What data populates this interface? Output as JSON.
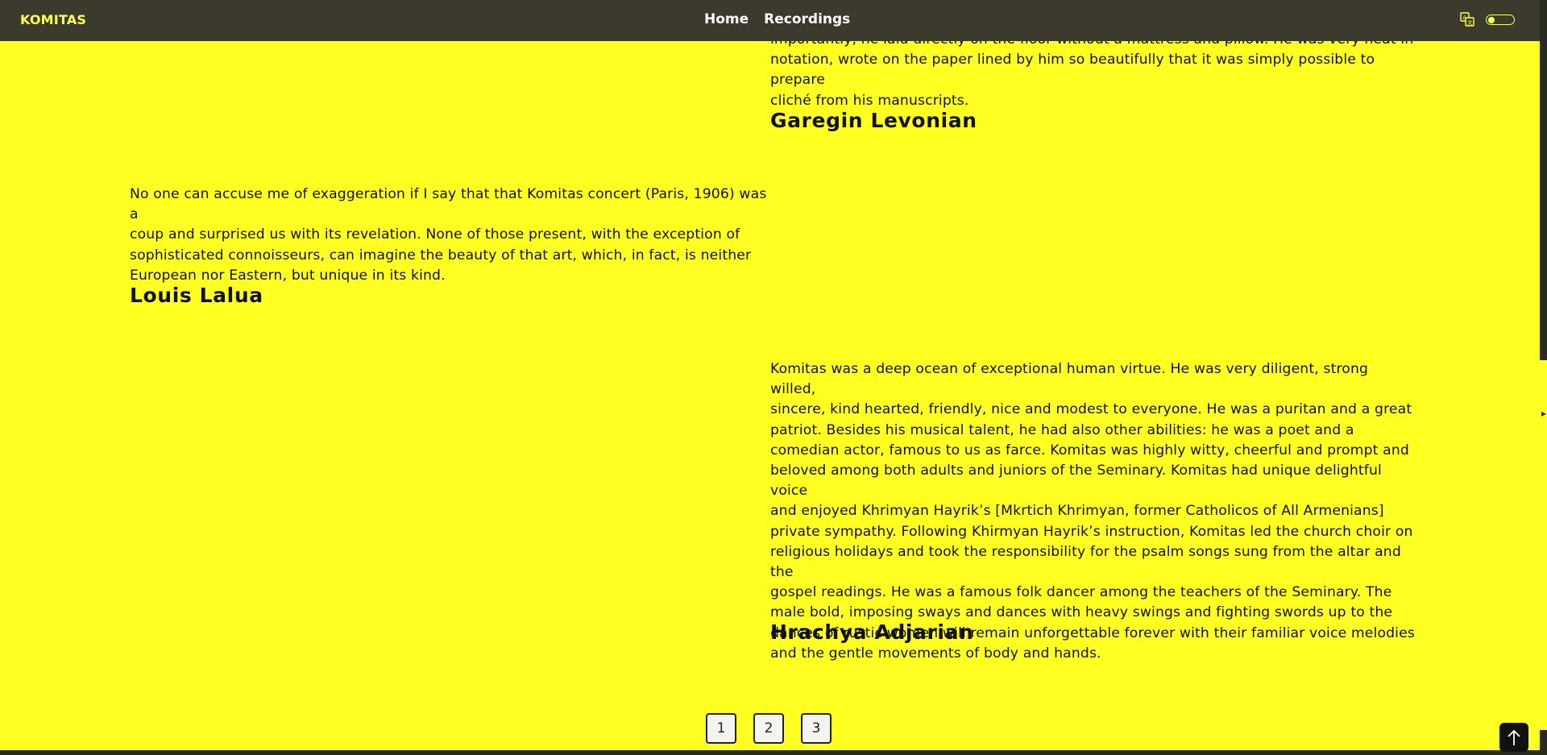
{
  "nav": {
    "brand": "KOMITAS",
    "links": [
      "Home",
      "Recordings"
    ]
  },
  "icons": {
    "translate": "translate-icon",
    "theme_toggle": "theme-toggle",
    "to_top": "arrow-up-icon"
  },
  "colors": {
    "page_background": "#ffff22",
    "navbar_background": "#3b3a2c",
    "brand_color": "#ffff55",
    "text_color": "#121212"
  },
  "quotes": [
    {
      "text_lines": [
        "importantly, he laid directly on the floor without a mattress and pillow. He was very neat in",
        "notation, wrote on the paper lined by him so beautifully that it was simply possible to prepare",
        "cliché from his manuscripts."
      ],
      "author": "Garegin Levonian"
    },
    {
      "text_lines": [
        "No one can accuse me of exaggeration if I say that that Komitas concert (Paris, 1906) was a",
        "coup and surprised us with its revelation. None of those present, with the exception of",
        "sophisticated connoisseurs, can imagine the beauty of that art, which, in fact, is neither",
        "European nor Eastern, but unique in its kind."
      ],
      "author": "Louis Lalua"
    },
    {
      "text_lines": [
        "Komitas was a deep ocean of exceptional human virtue. He was very diligent, strong willed,",
        "sincere, kind hearted, friendly, nice and modest to everyone. He was a puritan and a great",
        "patriot. Besides his musical talent, he had also other abilities: he was a poet and a",
        "comedian actor, famous to us as farce. Komitas was highly witty, cheerful and prompt and",
        "beloved among both adults and juniors of the Seminary. Komitas had unique delightful voice",
        "and enjoyed Khrimyan Hayrik’s [Mkrtich Khrimyan, former Catholicos of All Armenians]",
        "private sympathy. Following Khirmyan Hayrik’s instruction, Komitas led the church choir on",
        "religious holidays and took the responsibility for the psalm songs sung from the altar and the",
        "gospel readings. He was a famous folk dancer among the teachers of the Seminary. The",
        "male bold, imposing sways and dances with heavy swings and fighting swords up to the",
        "dances of rustic women will remain unforgettable forever with their familiar voice melodies",
        "and the gentle movements of body and hands."
      ],
      "author": "Hrachya Adjarian"
    }
  ],
  "pagination": {
    "pages": [
      "1",
      "2",
      "3"
    ]
  }
}
